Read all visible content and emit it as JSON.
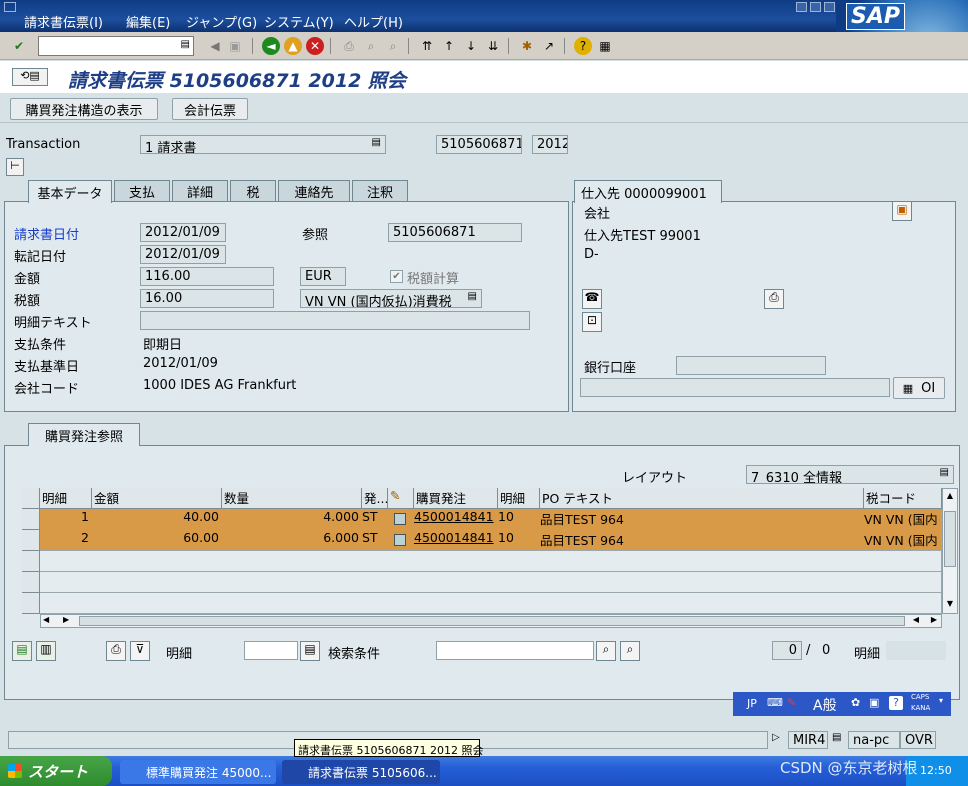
{
  "menubar": {
    "items": [
      "請求書伝票(I)",
      "編集(E)",
      "ジャンプ(G)",
      "システム(Y)",
      "ヘルプ(H)"
    ],
    "logo": "SAP"
  },
  "title": "請求書伝票 5105606871 2012 照会",
  "appbar": {
    "po_structure_button": "購買発注構造の表示",
    "accounting_doc_button": "会計伝票"
  },
  "header": {
    "transaction_label": "Transaction",
    "transaction_value": "1 請求書",
    "doc_number": "5105606871",
    "fiscal_year": "2012"
  },
  "tabs": [
    "基本データ",
    "支払",
    "詳細",
    "税",
    "連絡先",
    "注釈"
  ],
  "basic": {
    "invoice_date_label": "請求書日付",
    "invoice_date": "2012/01/09",
    "reference_label": "参照",
    "reference": "5105606871",
    "posting_date_label": "転記日付",
    "posting_date": "2012/01/09",
    "amount_label": "金額",
    "amount": "116.00",
    "currency": "EUR",
    "calc_tax_label": "税額計算",
    "tax_label": "税額",
    "tax": "16.00",
    "tax_code": "VN VN (国内仮払)消費税",
    "text_label": "明細テキスト",
    "text": "",
    "payment_terms_label": "支払条件",
    "payment_terms": "即期日",
    "baseline_label": "支払基準日",
    "baseline": "2012/01/09",
    "company_label": "会社コード",
    "company": "1000 IDES AG Frankfurt"
  },
  "vendor": {
    "tab": "仕入先 0000099001",
    "company_label": "会社",
    "name": "仕入先TEST 99001",
    "country": "D-",
    "bank_label": "銀行口座",
    "oi_button": "OI"
  },
  "po_section": {
    "tab": "購買発注参照",
    "layout_label": "レイアウト",
    "layout_value": "7_6310 全情報"
  },
  "grid": {
    "columns": [
      "明細",
      "金額",
      "数量",
      "発...",
      "",
      "購買発注",
      "明細",
      "PO テキスト",
      "税コード"
    ],
    "rows": [
      {
        "item": "1",
        "amount": "40.00",
        "qty": "4.000",
        "unit": "ST",
        "po": "4500014841",
        "po_item": "10",
        "text": "品目TEST 964",
        "tax": "VN VN (国内"
      },
      {
        "item": "2",
        "amount": "60.00",
        "qty": "6.000",
        "unit": "ST",
        "po": "4500014841",
        "po_item": "10",
        "text": "品目TEST 964",
        "tax": "VN VN (国内"
      }
    ]
  },
  "grid_footer": {
    "item_label": "明細",
    "search_label": "検索条件",
    "count": "0",
    "of": "/",
    "total": "0",
    "item_label2": "明細"
  },
  "ime": {
    "lang": "JP",
    "mode": "A般",
    "caps": "CAPS",
    "kana": "KANA"
  },
  "status": {
    "tooltip": "請求書伝票 5105606871 2012 照会",
    "transaction": "MIR4",
    "server": "na-pc",
    "mode": "OVR"
  },
  "taskbar": {
    "start": "スタート",
    "task1": "標準購買発注 45000...",
    "task2": "請求書伝票 5105606...",
    "clock": "12:50"
  },
  "watermark": "CSDN @东京老树根",
  "colors": {
    "highlight": "#d99a47",
    "title": "#1e3f86",
    "link": "#1a3cc8"
  }
}
